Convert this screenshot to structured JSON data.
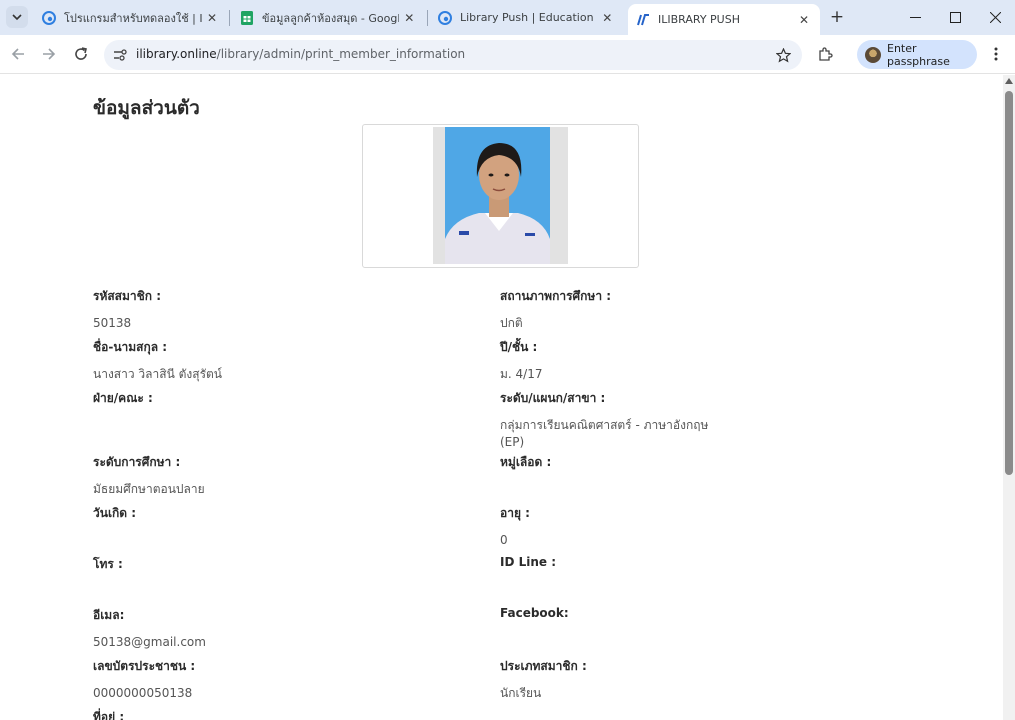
{
  "browser": {
    "tabs": [
      {
        "title": "โปรแกรมสำหรับทดลองใช้ | ILIBRARY",
        "favicon": "edge-blue-icon"
      },
      {
        "title": "ข้อมูลลูกค้าห้องสมุด - Google ชีต",
        "favicon": "sheets-icon"
      },
      {
        "title": "Library Push | Education Push",
        "favicon": "edge-blue-icon"
      },
      {
        "title": "ILIBRARY PUSH",
        "favicon": "ilibrary-logo-icon",
        "active": true
      }
    ],
    "url_host": "ilibrary.online",
    "url_path": "/library/admin/print_member_information",
    "profile_label": "Enter passphrase"
  },
  "page": {
    "title": "ข้อมูลส่วนตัว",
    "fields": {
      "member_id": {
        "label": "รหัสสมาชิก :",
        "value": "50138"
      },
      "study_status": {
        "label": "สถานภาพการศึกษา :",
        "value": "ปกติ"
      },
      "full_name": {
        "label": "ชื่อ-นามสกุล :",
        "value": "นางสาว วิลาสินี ตังสุรัตน์"
      },
      "year_level": {
        "label": "ปี/ชั้น :",
        "value": "ม. 4/17"
      },
      "faculty": {
        "label": "ฝ่าย/คณะ :",
        "value": ""
      },
      "program": {
        "label": "ระดับ/แผนก/สาขา :",
        "value": "กลุ่มการเรียนคณิตศาสตร์ - ภาษาอังกฤษ (EP)"
      },
      "education_level": {
        "label": "ระดับการศึกษา :",
        "value": "มัธยมศึกษาตอนปลาย"
      },
      "blood_group": {
        "label": "หมู่เลือด :",
        "value": ""
      },
      "birth_date": {
        "label": "วันเกิด :",
        "value": ""
      },
      "age": {
        "label": "อายุ :",
        "value": "0"
      },
      "phone": {
        "label": "โทร :",
        "value": ""
      },
      "line_id": {
        "label": "ID Line :",
        "value": ""
      },
      "email": {
        "label": "อีเมล:",
        "value": "50138@gmail.com"
      },
      "facebook": {
        "label": "Facebook:",
        "value": ""
      },
      "national_id": {
        "label": "เลขบัตรประชาชน :",
        "value": "0000000050138"
      },
      "member_type": {
        "label": "ประเภทสมาชิก :",
        "value": "นักเรียน"
      },
      "address": {
        "label": "ที่อยู่ :",
        "value": ""
      }
    }
  },
  "colors": {
    "tabstrip_bg": "#dfe8f6",
    "omnibox_bg": "#eef2f9",
    "profile_bg": "#d3e3fd",
    "photo_blue": "#4fa7e6"
  }
}
